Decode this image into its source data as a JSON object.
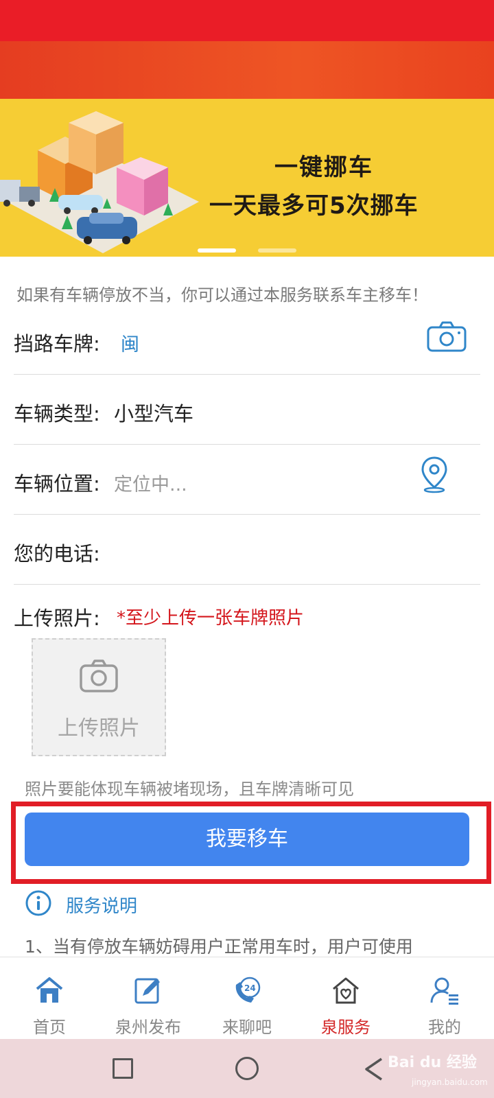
{
  "colors": {
    "status_bar": "#ea1d27",
    "banner_bg": "#f6cd34",
    "link_blue": "#2f86c9",
    "button_blue": "#4285ee",
    "warning_red": "#d4161c",
    "active_tab": "#d42a2a"
  },
  "banner": {
    "line1": "一键挪车",
    "line2": "一天最多可5次挪车",
    "slide_count": 2,
    "active_slide": 1
  },
  "form": {
    "intro": "如果有车辆停放不当，你可以通过本服务联系车主移车！",
    "plate_label": "挡路车牌:",
    "plate_value": "闽",
    "plate_icon": "camera-icon",
    "type_label": "车辆类型:",
    "type_value": "小型汽车",
    "location_label": "车辆位置:",
    "location_value": "定位中...",
    "location_icon": "map-pin-icon",
    "phone_label": "您的电话:",
    "phone_value": "",
    "upload_label": "上传照片:",
    "upload_hint": "*至少上传一张车牌照片",
    "upload_box_text": "上传照片",
    "photo_note": "照片要能体现车辆被堵现场，且车牌清晰可见",
    "submit_label": "我要移车"
  },
  "service": {
    "title": "服务说明",
    "text": "1、当有停放车辆妨碍用户正常用车时，用户可使用"
  },
  "tabbar": {
    "items": [
      {
        "label": "首页",
        "icon": "home-icon"
      },
      {
        "label": "泉州发布",
        "icon": "edit-icon"
      },
      {
        "label": "来聊吧",
        "icon": "phone-24-icon"
      },
      {
        "label": "泉服务",
        "icon": "heart-house-icon",
        "active": true
      },
      {
        "label": "我的",
        "icon": "user-icon"
      }
    ]
  },
  "watermark": {
    "main": "Bai du 经验",
    "sub": "jingyan.baidu.com"
  }
}
